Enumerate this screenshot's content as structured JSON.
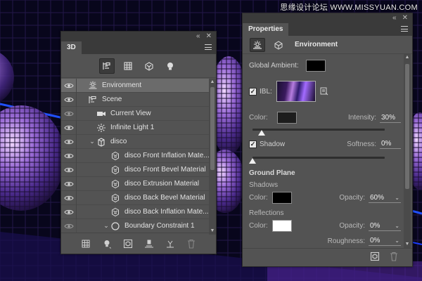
{
  "watermark": "思缘设计论坛 WWW.MISSYUAN.COM",
  "panel_3d": {
    "tab_label": "3D",
    "topbar": {
      "collapse_glyph": "«",
      "close_glyph": "✕"
    },
    "filter_icons": [
      "whole-scene-icon",
      "meshes-icon",
      "materials-icon",
      "lights-icon"
    ],
    "layers": [
      {
        "label": "Environment",
        "visible": true,
        "selected": true,
        "icon": "environment-icon",
        "indent": 0
      },
      {
        "label": "Scene",
        "visible": true,
        "selected": false,
        "icon": "scene-icon",
        "indent": 0
      },
      {
        "label": "Current View",
        "visible": false,
        "selected": false,
        "icon": "camera-icon",
        "indent": 1
      },
      {
        "label": "Infinite Light 1",
        "visible": true,
        "selected": false,
        "icon": "light-icon",
        "indent": 1
      },
      {
        "label": "disco",
        "visible": true,
        "selected": false,
        "icon": "mesh-icon",
        "indent": 1,
        "twisty": "⌄"
      },
      {
        "label": "disco Front Inflation Mate...",
        "visible": true,
        "selected": false,
        "icon": "material-icon",
        "indent": 2
      },
      {
        "label": "disco Front Bevel Material",
        "visible": true,
        "selected": false,
        "icon": "material-icon",
        "indent": 2
      },
      {
        "label": "disco Extrusion Material",
        "visible": true,
        "selected": false,
        "icon": "material-icon",
        "indent": 2
      },
      {
        "label": "disco Back Bevel Material",
        "visible": true,
        "selected": false,
        "icon": "material-icon",
        "indent": 2
      },
      {
        "label": "disco Back Inflation Mate...",
        "visible": true,
        "selected": false,
        "icon": "material-icon",
        "indent": 2
      },
      {
        "label": "Boundary Constraint 1",
        "visible": false,
        "selected": false,
        "icon": "constraint-icon",
        "indent": 2,
        "twisty": "⌄"
      }
    ],
    "bottom_icons": [
      "mesh-tool-icon",
      "add-light-icon",
      "render-icon",
      "drop-to-plane-icon",
      "split-icon",
      "trash-icon"
    ]
  },
  "panel_props": {
    "tab_label": "Properties",
    "header_title": "Environment",
    "global_ambient_label": "Global Ambient:",
    "global_ambient_color": "#000000",
    "ibl_label": "IBL:",
    "ibl_checked": true,
    "color_label": "Color:",
    "intensity_label": "Intensity:",
    "intensity_value": "30%",
    "intensity_level": 0.07,
    "shadow_label": "Shadow",
    "shadow_checked": true,
    "softness_label": "Softness:",
    "softness_value": "0%",
    "softness_level": 0.0,
    "ground_plane_label": "Ground Plane",
    "shadows_label": "Shadows",
    "shadows_color_label": "Color:",
    "shadows_opacity_label": "Opacity:",
    "shadows_opacity_value": "60%",
    "reflections_label": "Reflections",
    "reflections_color_label": "Color:",
    "reflections_opacity_label": "Opacity:",
    "reflections_opacity_value": "0%",
    "roughness_label": "Roughness:",
    "roughness_value": "0%"
  }
}
